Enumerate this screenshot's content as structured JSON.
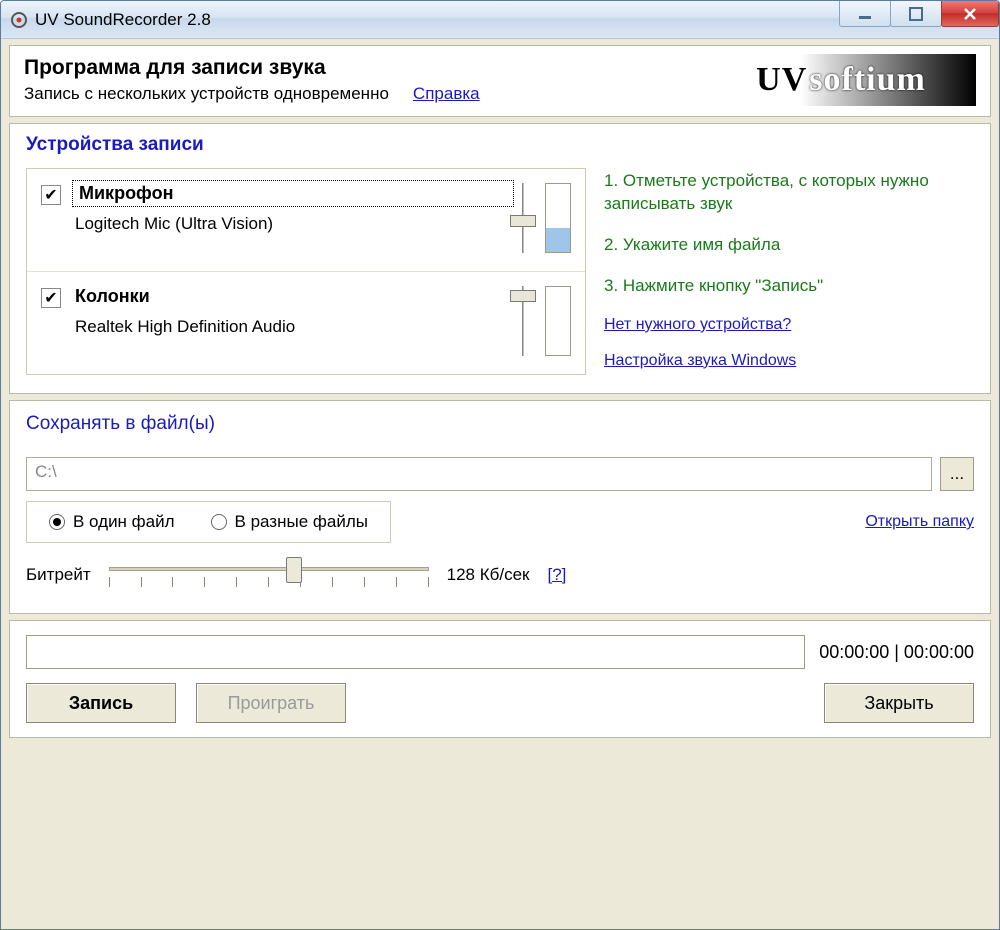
{
  "window": {
    "title": "UV SoundRecorder 2.8"
  },
  "header": {
    "title": "Программа для записи звука",
    "subtitle": "Запись с нескольких устройств одновременно",
    "help_link": "Справка",
    "brand_uv": "UV",
    "brand_soft": "softium"
  },
  "devices": {
    "section_title": "Устройства записи",
    "items": [
      {
        "checked": true,
        "name": "Микрофон",
        "focused": true,
        "sub": "Logitech Mic (Ultra Vision)",
        "slider_pos_pct": 45,
        "level_pct": 35
      },
      {
        "checked": true,
        "name": "Колонки",
        "focused": false,
        "sub": "Realtek High Definition Audio",
        "slider_pos_pct": 5,
        "level_pct": 0
      }
    ],
    "hints": [
      "1. Отметьте устройства, с которых нужно записывать звук",
      "2. Укажите имя файла",
      "3. Нажмите кнопку \"Запись\""
    ],
    "links": [
      "Нет нужного устройства?",
      "Настройка звука Windows"
    ]
  },
  "save": {
    "section_title": "Сохранять в файл(ы)",
    "path_value": "C:\\",
    "browse_label": "...",
    "radios": {
      "one_file": "В один файл",
      "many_files": "В разные файлы",
      "selected": "one_file"
    },
    "open_folder_link": "Открыть папку",
    "bitrate_label": "Битрейт",
    "bitrate_value": "128 Кб/сек",
    "bitrate_help": "[?]",
    "bitrate_slider_pct": 58
  },
  "bottom": {
    "time": "00:00:00 | 00:00:00",
    "record_btn": "Запись",
    "play_btn": "Проиграть",
    "close_btn": "Закрыть"
  }
}
